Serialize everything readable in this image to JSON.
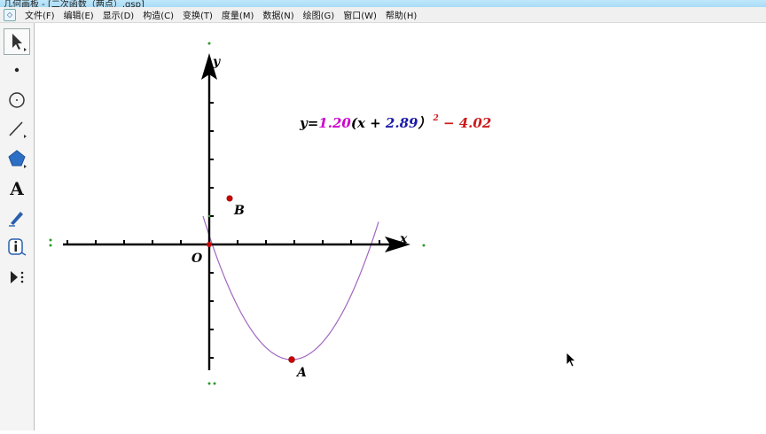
{
  "window": {
    "title": "几何画板 - [二次函数（两点）.gsp]"
  },
  "menubar": {
    "items": [
      "文件(F)",
      "编辑(E)",
      "显示(D)",
      "构造(C)",
      "变换(T)",
      "度量(M)",
      "数据(N)",
      "绘图(G)",
      "窗口(W)",
      "帮助(H)"
    ]
  },
  "toolbox": {
    "tools": [
      "arrow-tool",
      "point-tool",
      "compass-tool",
      "straightedge-tool",
      "polygon-tool",
      "text-tool",
      "marker-tool",
      "information-tool",
      "custom-tool"
    ],
    "selected": "arrow-tool",
    "text_tool_glyph": "A"
  },
  "graph": {
    "x_axis_label": "x",
    "y_axis_label": "y",
    "origin_label": "O",
    "point_a_label": "A",
    "point_b_label": "B",
    "equation": {
      "y_equals": "y=",
      "a_value": "1.20",
      "open_part": "(x + ",
      "h_value": "2.89",
      "close_paren": "）",
      "exponent": "2",
      "minus": " − ",
      "k_value": "4.02"
    },
    "colors": {
      "curve": "#a066c0",
      "axes": "#000000",
      "point": "#cc0000",
      "a_value": "#cc00cc",
      "h_value": "#1a1aa8",
      "k_value": "#cc1a1a",
      "handle": "#2e9b2e"
    }
  }
}
